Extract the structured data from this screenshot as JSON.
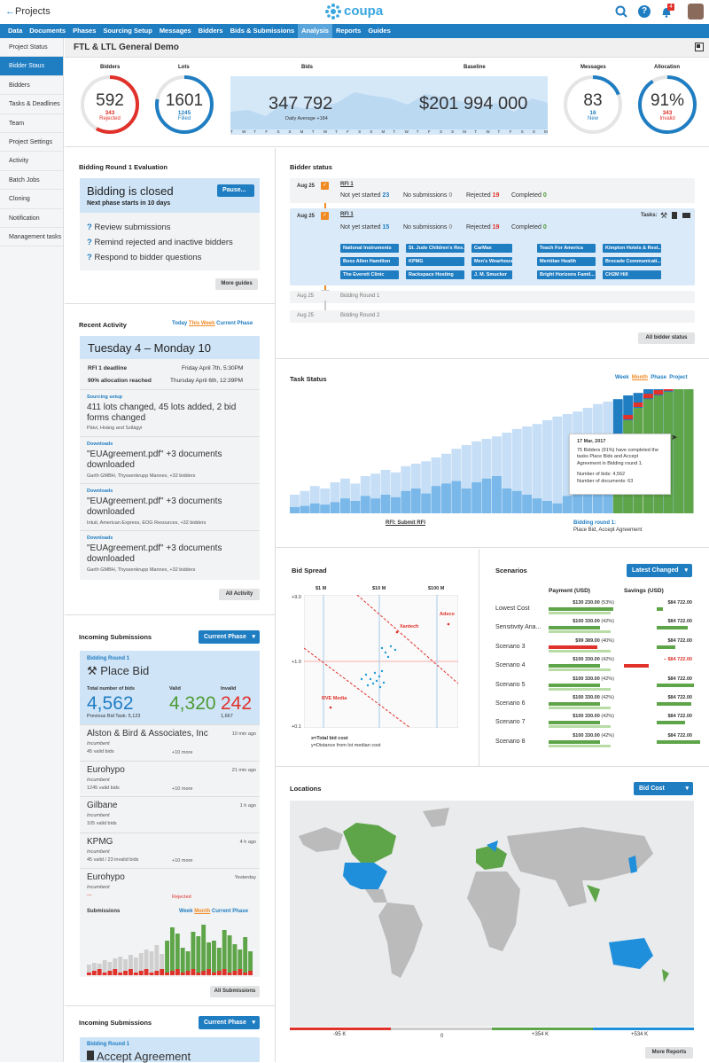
{
  "header": {
    "back_label": "Projects",
    "logo": "coupa",
    "notif_count": "4"
  },
  "nav": [
    "Data",
    "Documents",
    "Phases",
    "Sourcing Setup",
    "Messages",
    "Bidders",
    "Bids & Submissions",
    "Analysis",
    "Reports",
    "Guides"
  ],
  "sidebar": [
    "Project Status",
    "Bidder Staus",
    "Bidders",
    "Tasks & Deadlines",
    "Team",
    "Project Settings",
    "Activity",
    "Batch Jobs",
    "Cloning",
    "Notification",
    "Management tasks"
  ],
  "project_title": "FTL & LTL General Demo",
  "kpi": {
    "bidders": {
      "label": "Bidders",
      "value": "592",
      "sub_value": "343",
      "sub_label": "Rejected",
      "fraction": 0.58
    },
    "lots": {
      "label": "Lots",
      "value": "1601",
      "sub_value": "1245",
      "sub_label": "Filled",
      "fraction": 0.78
    },
    "bids": {
      "label": "Bids",
      "value": "347 792",
      "sub": "Daily Average +184"
    },
    "baseline": {
      "label": "Baseline",
      "value": "$201 994 000"
    },
    "days": [
      "T",
      "W",
      "T",
      "F",
      "S",
      "S",
      "M",
      "T",
      "W",
      "T",
      "F",
      "S",
      "S",
      "M",
      "T",
      "W",
      "T",
      "F",
      "S",
      "S",
      "M",
      "T",
      "W",
      "T",
      "F",
      "S",
      "S",
      "M"
    ],
    "messages": {
      "label": "Messages",
      "value": "83",
      "sub_value": "16",
      "sub_label": "New",
      "fraction": 0.19
    },
    "allocation": {
      "label": "Allocation",
      "value": "91%",
      "sub_value": "343",
      "sub_label": "Invalid",
      "fraction": 0.91
    }
  },
  "eval": {
    "title": "Bidding Round 1 Evaluation",
    "status": "Bidding is closed",
    "pause": "Pause...",
    "next": "Next phase starts in 10 days",
    "guides": [
      "Review submissions",
      "Remind rejected and inactive bidders",
      "Respond to bidder questions"
    ],
    "more": "More guides"
  },
  "bidder_status": {
    "title": "Bidder status",
    "rows": [
      {
        "date": "Aug 25",
        "name": "RFI 1",
        "nys_label": "Not yet started",
        "nys": "23",
        "nosub_label": "No submissions",
        "nosub": "0",
        "rej_label": "Rejected",
        "rej": "19",
        "comp_label": "Completed",
        "comp": "0"
      },
      {
        "date": "Aug 25",
        "name": "RFI 1",
        "nys_label": "Not yet started",
        "nys": "15",
        "nosub_label": "No submissions",
        "nosub": "0",
        "rej_label": "Rejected",
        "rej": "19",
        "comp_label": "Completed",
        "comp": "0",
        "tasks": "Tasks:"
      }
    ],
    "tags": [
      "National Instruments",
      "St. Jude Children's Res...",
      "CarMax",
      "Teach For America",
      "Kimpton Hotels & Rest...",
      "Booz Allen Hamilton",
      "KPMG",
      "Men's Wearhouse",
      "Meridian Health",
      "Brocade Communicati...",
      "The Everett Clinic",
      "Rackspace Hosting",
      "J. M. Smucker",
      "Bright Horizons Famil...",
      "CH2M Hill"
    ],
    "future": [
      {
        "date": "Aug 25",
        "name": "Bidding Round 1"
      },
      {
        "date": "Aug 25",
        "name": "Bidding Round 2"
      }
    ],
    "all": "All bidder status"
  },
  "activity": {
    "title": "Recent Activity",
    "filters": [
      "Today",
      "This Week",
      "Current Phase"
    ],
    "range": "Tuesday  4 – Monday 10",
    "deadlines": [
      {
        "label": "RFI 1 deadline",
        "date": "Friday April 7th, 5:30PM"
      },
      {
        "label": "90% allocation reached",
        "date": "Thursday April 6th, 12:39PM"
      }
    ],
    "items": [
      {
        "cat": "Sourcing setup",
        "text": "411 lots changed, 45 lots added, 2 bid forms changed",
        "who": "Päivi, Hoàng and Szilágyi"
      },
      {
        "cat": "Downloads",
        "text": "\"EUAgreement.pdf\" +3 documents downloaded",
        "who": "Garth GMBH, Thyssenkrupp Mannex, +32 bidders"
      },
      {
        "cat": "Downloads",
        "text": "\"EUAgreement.pdf\" +3 documents downloaded",
        "who": "Intuit, American Express, EOG Resources, +32 bidders"
      },
      {
        "cat": "Downloads",
        "text": "\"EUAgreement.pdf\" +3 documents downloaded",
        "who": "Garth GMBH, Thyssenkrupp Mannex, +32 bidders"
      }
    ],
    "all": "All Activity"
  },
  "task_status": {
    "title": "Task Status",
    "filters": [
      "Week",
      "Month",
      "Phase",
      "Project"
    ],
    "tooltip": {
      "date": "17 Mar, 2017",
      "text": "75 Bidders (91%) have completed the tasks Place Bids and Accept Agreement in Bidding round 1.",
      "bids": "Number of bids: 4,562",
      "docs": "Number of documents: 63"
    },
    "label_left": "RFI: Submit RFI",
    "label_right": "Bidding round 1:",
    "label_right2": "Place Bid, Accept Agreement",
    "chart_data": {
      "type": "bar",
      "series": [
        {
          "name": "total",
          "values": [
            15,
            18,
            22,
            20,
            25,
            28,
            24,
            30,
            32,
            35,
            33,
            38,
            40,
            42,
            45,
            48,
            52,
            55,
            58,
            60,
            62,
            65,
            68,
            70,
            72,
            75,
            78,
            80,
            82,
            85,
            88,
            90,
            92,
            95,
            97,
            100,
            100,
            100,
            100,
            100
          ]
        },
        {
          "name": "done",
          "values": [
            5,
            6,
            8,
            7,
            9,
            12,
            10,
            14,
            12,
            15,
            13,
            18,
            20,
            16,
            22,
            24,
            26,
            20,
            25,
            28,
            30,
            20,
            18,
            15,
            12,
            10,
            8,
            14,
            20,
            28,
            35,
            45,
            60,
            75,
            85,
            92,
            95,
            98,
            100,
            100
          ]
        }
      ]
    }
  },
  "bid_spread": {
    "title": "Bid Spread",
    "x_ticks": [
      "$1 M",
      "$10 M",
      "$100 M"
    ],
    "y_ticks": [
      "+9.0",
      "+1.0",
      "+0.1"
    ],
    "labels": [
      "Xantech",
      "Adeco",
      "RVE Media"
    ],
    "xnote": "x=Total bid cost",
    "ynote": "y=Distance from lot median cost"
  },
  "scenarios": {
    "title": "Scenarios",
    "dropdown": "Latest Changed",
    "col1": "Payment (USD)",
    "col2": "Savings (USD)",
    "rows": [
      {
        "name": "Lowest Cost",
        "pay": "$130 230.00",
        "pct": "(53%)",
        "sav": "$84 722.00",
        "p": 0.53,
        "s": 0.1,
        "neg": false
      },
      {
        "name": "Sensitivity Ana...",
        "pay": "$100 330.00",
        "pct": "(42%)",
        "sav": "$84 722.00",
        "p": 0.42,
        "s": 0.5,
        "neg": false
      },
      {
        "name": "Scenario 3",
        "pay": "$99 389.00",
        "pct": "(40%)",
        "sav": "$84 722.00",
        "p": 0.4,
        "s": 0.3,
        "neg": false
      },
      {
        "name": "Scenario 4",
        "pay": "$100 330.00",
        "pct": "(42%)",
        "sav": "– $84 722.00",
        "p": 0.42,
        "s": 0.4,
        "neg": true
      },
      {
        "name": "Scenario 5",
        "pay": "$100 330.00",
        "pct": "(42%)",
        "sav": "$84 722.00",
        "p": 0.42,
        "s": 0.6,
        "neg": false
      },
      {
        "name": "Scenario 6",
        "pay": "$100 330.00",
        "pct": "(42%)",
        "sav": "$84 722.00",
        "p": 0.42,
        "s": 0.55,
        "neg": false
      },
      {
        "name": "Scenario 7",
        "pay": "$100 330.00",
        "pct": "(42%)",
        "sav": "$84 722.00",
        "p": 0.42,
        "s": 0.45,
        "neg": false
      },
      {
        "name": "Scenario 8",
        "pay": "$100 330.00",
        "pct": "(42%)",
        "sav": "$84 722.00",
        "p": 0.42,
        "s": 0.7,
        "neg": false
      }
    ]
  },
  "incoming": {
    "title": "Incoming Submissions",
    "dropdown": "Current Phase",
    "round": "Bidding Round 1",
    "task": "Place Bid",
    "total_label": "Total number of bids",
    "total": "4,562",
    "prev": "Previous Bid Task: 5,123",
    "valid_label": "Valid",
    "valid": "4,320",
    "invalid_label": "Invalid",
    "invalid": "242",
    "invalid_sub": "1,667",
    "list": [
      {
        "name": "Alston & Bird & Associates, Inc",
        "time": "10 min ago",
        "role": "Incumbent",
        "bids": "45 valid bids",
        "more": "+10 more"
      },
      {
        "name": "Eurohypo",
        "time": "21 min ago",
        "role": "Incumbent",
        "bids": "1245 valid bids",
        "more": "+10 more"
      },
      {
        "name": "Gilbane",
        "time": "1 h ago",
        "role": "Incumbent",
        "bids": "105 valid bids",
        "more": ""
      },
      {
        "name": "KPMG",
        "time": "4 h ago",
        "role": "Incumbent",
        "bids": "45 valid / 23 invalid bids",
        "more": "+10 more"
      },
      {
        "name": "Eurohypo",
        "time": "Yesterday",
        "role": "Incumbent",
        "bids": "—",
        "more": "Rejected"
      }
    ],
    "sub_title": "Submissions",
    "sub_filters": [
      "Week",
      "Month",
      "Current Phase"
    ],
    "all": "All Submissions"
  },
  "incoming2": {
    "title": "Incoming Submissions",
    "dropdown": "Current Phase",
    "round": "Bidding Round 1",
    "task": "Accept Agreement"
  },
  "locations": {
    "title": "Locations",
    "dropdown": "Bid Cost",
    "scale": [
      "-95 K",
      "0",
      "+354 K",
      "+534 K"
    ],
    "more": "More Reports"
  }
}
